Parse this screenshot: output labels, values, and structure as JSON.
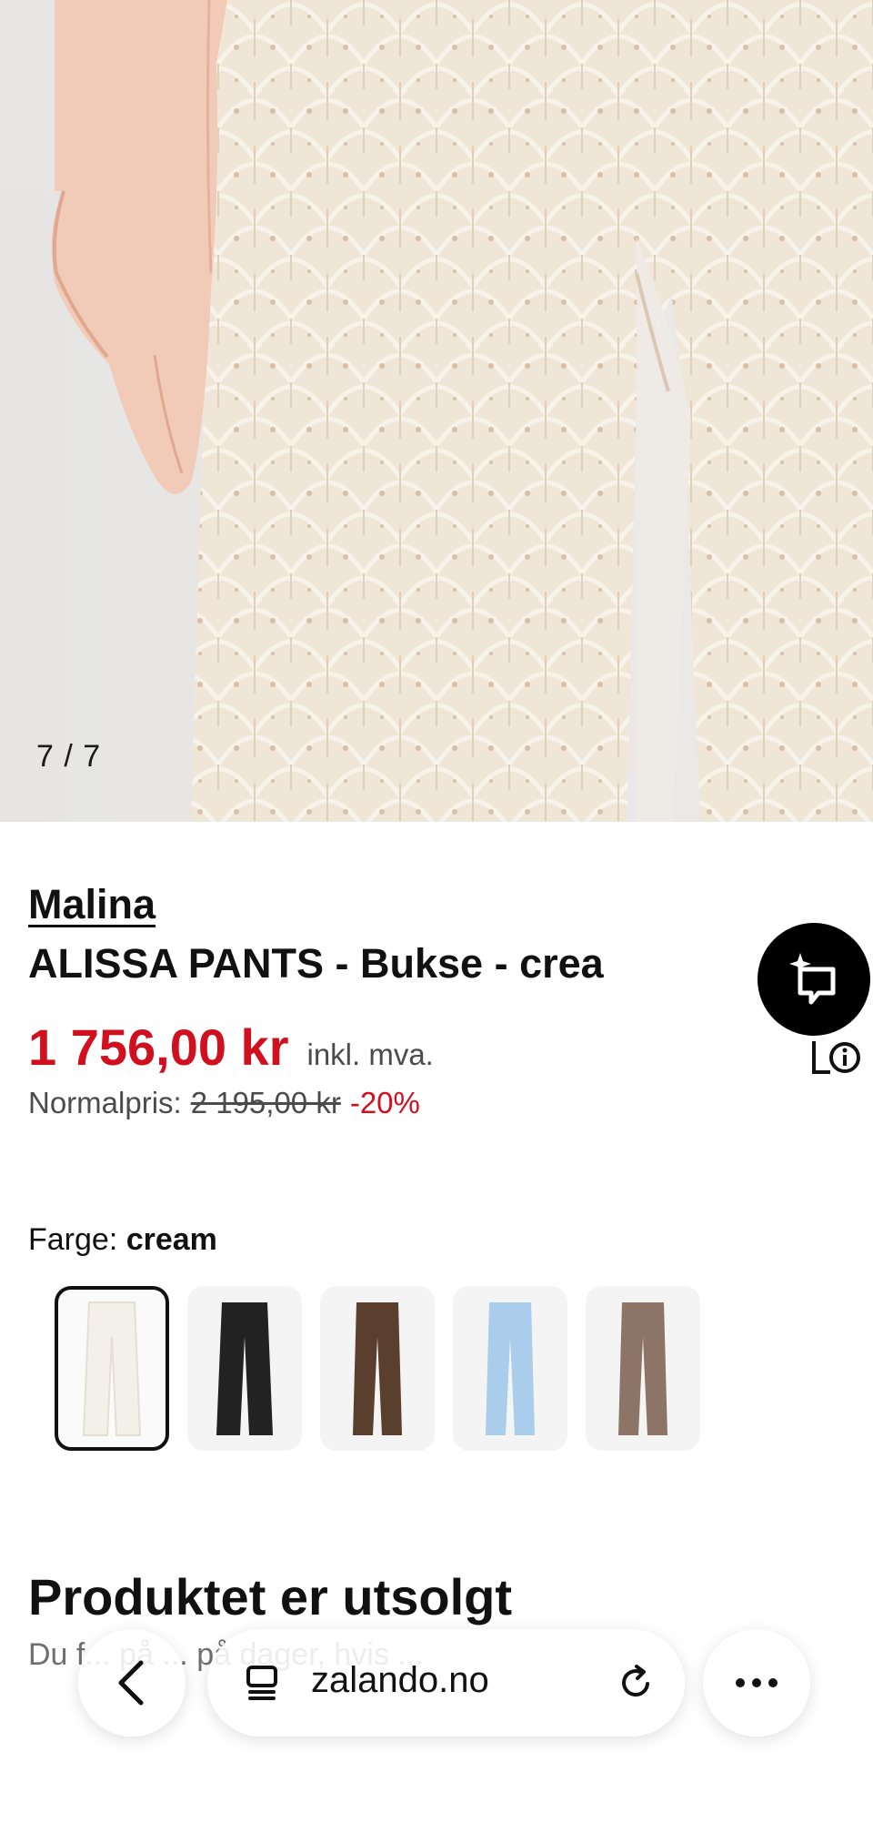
{
  "gallery": {
    "counter": "7 / 7",
    "fabric_color": "#efe4d4"
  },
  "product": {
    "brand": "Malina",
    "title": "ALISSA PANTS - Bukse - crea",
    "price": "1 756,00 kr",
    "vat_note": "inkl. mva.",
    "normal_label": "Normalpris:",
    "normal_price": "2 195,00 kr",
    "discount": "-20%",
    "sale_color": "#d0101e"
  },
  "color_picker": {
    "label": "Farge:",
    "selected": "cream",
    "swatches": [
      {
        "name": "cream",
        "color": "#f3f0ea"
      },
      {
        "name": "black",
        "color": "#222222"
      },
      {
        "name": "brown",
        "color": "#5a3e2e"
      },
      {
        "name": "light-blue",
        "color": "#a9cdea"
      },
      {
        "name": "taupe",
        "color": "#8c7466"
      }
    ]
  },
  "availability": {
    "title": "Produktet er utsolgt",
    "description": "Du f... på ... på dager, hvis ... "
  },
  "browser": {
    "url": "zalando.no",
    "icons": [
      "back-icon",
      "tabs-icon",
      "reload-icon",
      "more-icon"
    ]
  }
}
